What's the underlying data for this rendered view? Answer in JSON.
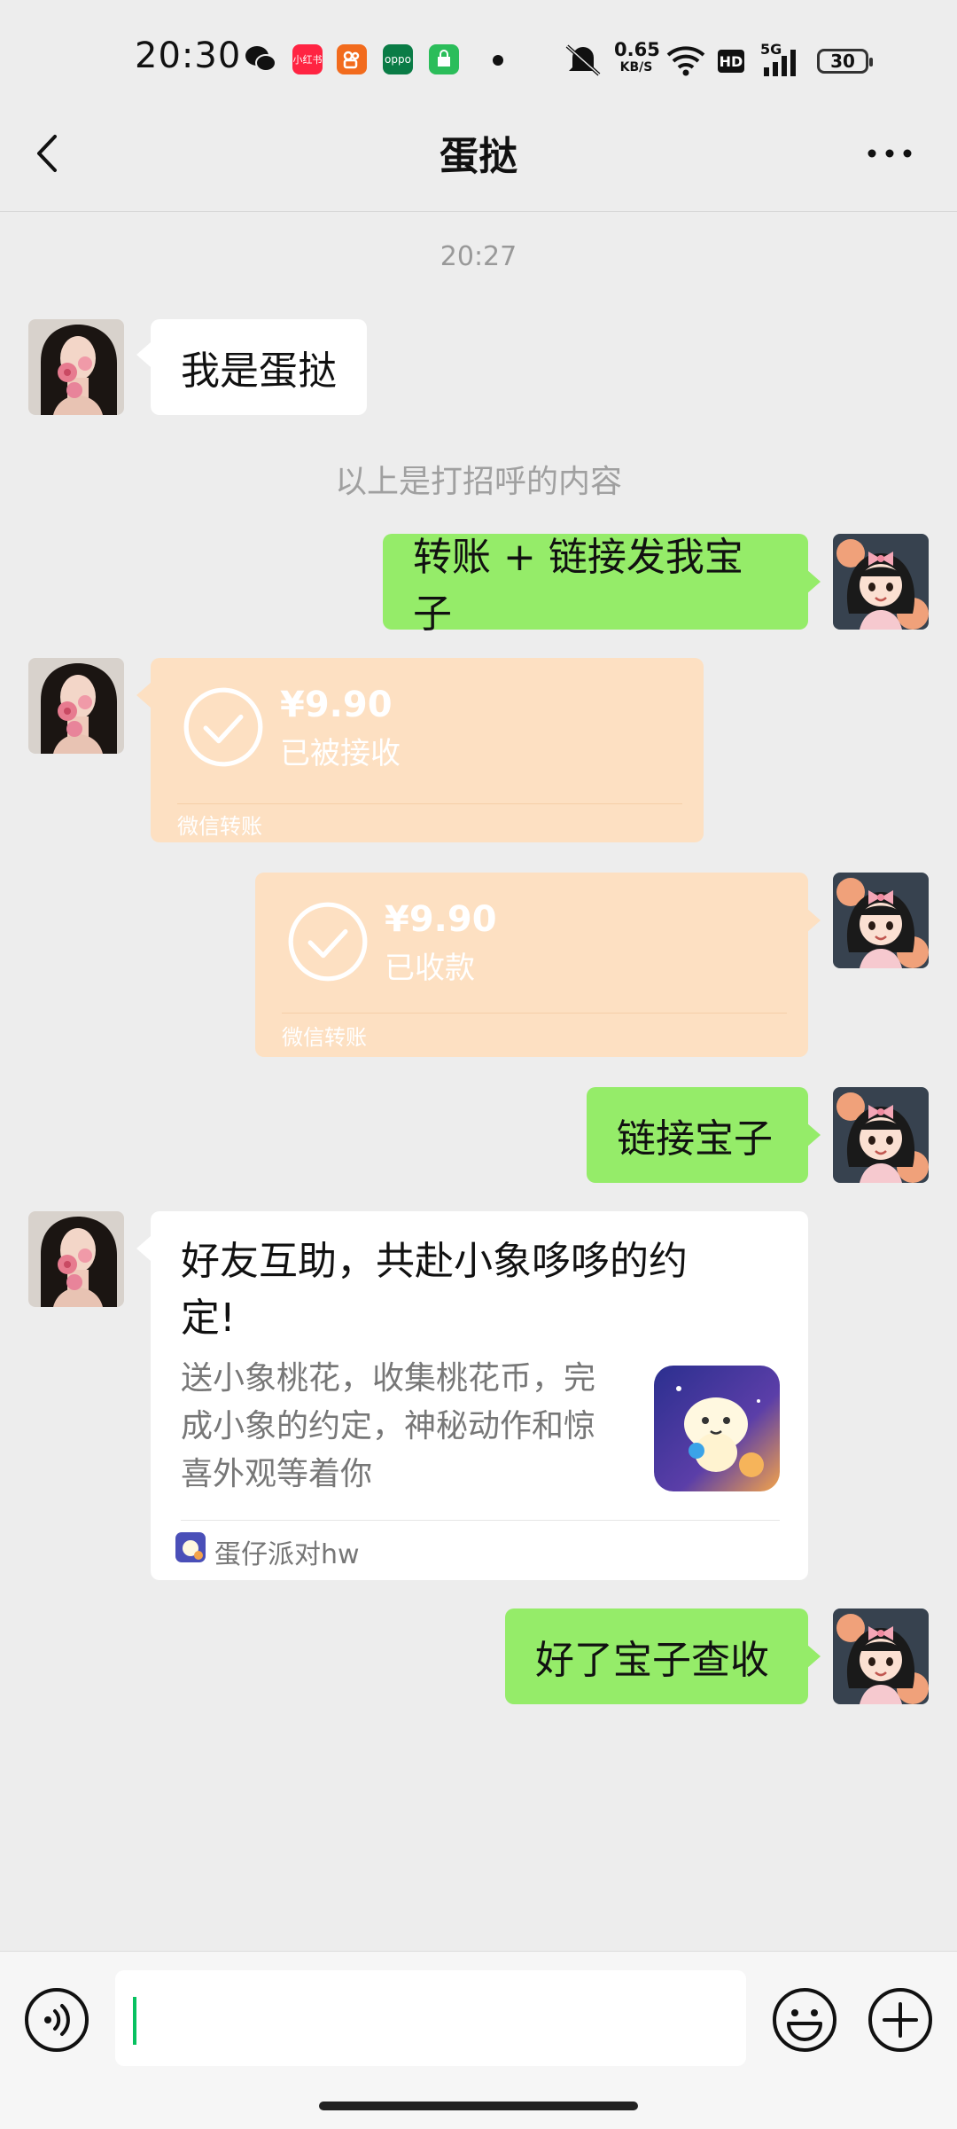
{
  "status_bar": {
    "time": "20:30",
    "speed_value": "0.65",
    "speed_unit": "KB/S",
    "hd": "HD",
    "network": "5G",
    "battery": "30",
    "xiaohongshu_label": "小红书",
    "oppo_label": "oppo"
  },
  "header": {
    "title": "蛋挞"
  },
  "chat": {
    "timestamp": "20:27",
    "system_note": "以上是打招呼的内容",
    "msg1": "我是蛋挞",
    "msg2": "转账 + 链接发我宝子",
    "transfer_in": {
      "amount": "¥9.90",
      "status": "已被接收",
      "footer": "微信转账"
    },
    "transfer_out": {
      "amount": "¥9.90",
      "status": "已收款",
      "footer": "微信转账"
    },
    "msg3": "链接宝子",
    "card": {
      "title_line1": "好友互助，共赴小象哆哆的约",
      "title_line2": "定!",
      "desc_line1": "送小象桃花，收集桃花币，完",
      "desc_line2": "成小象的约定，神秘动作和惊",
      "desc_line3": "喜外观等着你",
      "source": "蛋仔派对hw"
    },
    "msg4": "好了宝子查收"
  },
  "colors": {
    "background": "#ededed",
    "outgoing_bubble": "#95ec69",
    "incoming_bubble": "#ffffff",
    "transfer_bubble": "#fde0c2",
    "cursor": "#07c160"
  },
  "icons": [
    "back-icon",
    "more-icon",
    "voice-icon",
    "emoji-icon",
    "plus-icon",
    "check-icon"
  ]
}
